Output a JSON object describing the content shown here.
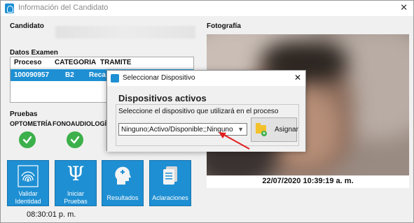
{
  "window": {
    "title": "Información del Candidato",
    "close": "✕"
  },
  "candidate": {
    "label": "Candidato"
  },
  "exam": {
    "label": "Datos Examen",
    "columns": [
      "Proceso",
      "CATEGORIA",
      "TRAMITE"
    ],
    "rows": [
      {
        "proceso": "100090957",
        "categoria": "B2",
        "tramite": "Reca"
      }
    ]
  },
  "tests": {
    "label": "Pruebas",
    "items": [
      {
        "label": "OPTOMETRÍA",
        "status": "ok"
      },
      {
        "label": "FONOAUDIOLOGÍA",
        "status": "ok"
      }
    ]
  },
  "actions": [
    {
      "label_line1": "Validar",
      "label_line2": "Identidad",
      "icon": "fingerprint-icon"
    },
    {
      "label_line1": "Iniciar",
      "label_line2": "Pruebas",
      "icon": "psi-icon"
    },
    {
      "label_line1": "Resultados",
      "label_line2": "",
      "icon": "head-plus-icon"
    },
    {
      "label_line1": "Aclaraciones",
      "label_line2": "",
      "icon": "documents-icon"
    }
  ],
  "clock": "08:30:01 p. m.",
  "photo": {
    "label": "Fotografía",
    "timestamp": "22/07/2020 10:39:19 a. m."
  },
  "dialog": {
    "title": "Seleccionar Dispositivo",
    "close": "✕",
    "heading": "Dispositivos activos",
    "prompt": "Seleccione el dispositivo que utilizará en el proceso",
    "selected_device": "Ninguno;Activo/Disponible;;Ninguno",
    "assign_label": "Asignar"
  },
  "colors": {
    "accent": "#1e8fd3",
    "success": "#3cb04a",
    "annotation": "#e02020"
  }
}
